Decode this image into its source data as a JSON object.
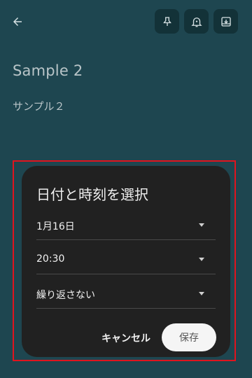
{
  "header": {
    "back_icon": "arrow-back-icon",
    "actions": [
      "pin-icon",
      "reminder-icon",
      "archive-icon"
    ]
  },
  "note": {
    "title": "Sample 2",
    "body": "サンプル２"
  },
  "dialog": {
    "title": "日付と時刻を選択",
    "date": "1月16日",
    "time": "20:30",
    "repeat": "繰り返さない",
    "cancel_label": "キャンセル",
    "save_label": "保存"
  },
  "colors": {
    "background": "#1e4650",
    "dialog": "#212121",
    "highlight": "#e0141e"
  }
}
